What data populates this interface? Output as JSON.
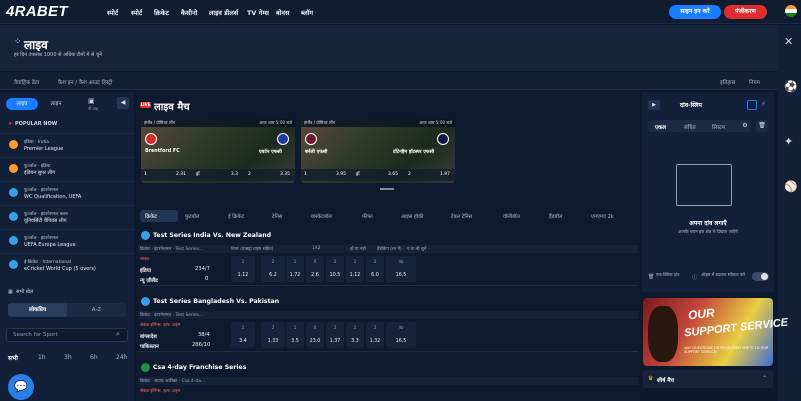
{
  "logo": "4RABET",
  "nav": [
    "स्पोर्ट",
    "स्पोर्ट",
    "क्रिकेट",
    "कैसीनो",
    "लाइव डीलर्स",
    "TV गेम्स",
    "बोनस",
    "ब्लॉग"
  ],
  "auth": {
    "login": "साइन इन करें",
    "register": "पंजीकरण"
  },
  "hero": {
    "title": "लाइव",
    "subtitle": "हर दिन उपलब्ध 1000 से अधिक टीमों में से चुनें"
  },
  "subnav": [
    "वैवाहिक ढेटा",
    "कैश इन / कैश आउट हिस्ट्री",
    "इतिहास",
    "नियम"
  ],
  "rightrail": [
    "",
    "",
    "",
    "",
    ""
  ],
  "sidebar": {
    "tab_live": "लाइव",
    "tab_prematch": "लाइन",
    "tab_extra": "नो वाद",
    "popular": "POPULAR NOW",
    "items": [
      {
        "l1": "इंडिया · India",
        "l2": "Premier League",
        "color": "#ff9933"
      },
      {
        "l1": "फुटबॉल · इंडिया",
        "l2": "इंडियन सुपर लीग",
        "color": "#ff9933"
      },
      {
        "l1": "फुटबॉल · इंटरनेशनल",
        "l2": "WC Qualification, UEFA",
        "color": "#3aa0e8"
      },
      {
        "l1": "फुटबॉल · इंटरनेशनल क्लब",
        "l2": "यूनिवर्सिटी चैंपियंस लीग",
        "color": "#3aa0e8"
      },
      {
        "l1": "फुटबॉल · इंटरनेशनल",
        "l2": "UEFA Europa League",
        "color": "#3aa0e8"
      },
      {
        "l1": "ई-क्रिकेट · International",
        "l2": "eCricket World Cup (5 overs)",
        "color": "#3aa0e8"
      }
    ],
    "all_sports": "सभी खेल",
    "seg_popular": "लोकप्रिय",
    "seg_az": "A-Z",
    "search_placeholder": "Search for Sport",
    "time_filters": [
      "सभी",
      "1h",
      "3h",
      "6h",
      "24h"
    ]
  },
  "main": {
    "live_badge": "LIVE",
    "title": "लाइव मैच",
    "cards": [
      {
        "league": "इंग्लैंड / प्रीमियर लीग",
        "time": "आज शाम 5:00 बजे",
        "home": "Brentford FC",
        "away": "एवर्टन एफसी",
        "o1": "2.31",
        "ox": "3.3",
        "o2": "3.35"
      },
      {
        "league": "इंग्लैंड / प्रीमियर लीग",
        "time": "आज शाम 5:00 बजे",
        "home": "बर्नली एफसी",
        "away": "टॉटेनहैम हॉटस्पर एफसी",
        "o1": "3.95",
        "ox": "3.65",
        "o2": "1.97"
      }
    ],
    "sport_tabs": [
      "क्रिकेट",
      "फुटबॉल",
      "ई क्रिकेट",
      "टेनिस",
      "बास्केटबॉल",
      "फीफा",
      "आइस हॉकी",
      "टेबल टेनिस",
      "वॉलीबॉल",
      "हैंडबॉल",
      "एमएमए 2k"
    ],
    "league1": {
      "name": "Test Series India Vs. New Zealand",
      "sub": "क्रिकेट · इंटरनेशनल · Test Series...",
      "h1": "विनर (एक्स्ट्रा टाइम सहित)",
      "h2": "1X2",
      "h3": "हाँ या नहीं",
      "h4": "हैंडीकैप (रन में)",
      "h5": "ए या बी चुनें",
      "live": "लाइव",
      "team1": "इंडिया",
      "team2": "न्यू ज़ीलैंड",
      "score1": "234/7",
      "score2": "0",
      "cells": [
        "1",
        "1.12",
        "2",
        "6.2",
        "1",
        "1.72",
        "X",
        "2.6",
        "2",
        "10.5",
        "1",
        "1.12",
        "2",
        "6.0",
        "पेड",
        "16.5"
      ]
    },
    "league2": {
      "name": "Test Series Bangladesh Vs. Pakistan",
      "sub": "क्रिकेट · इंटरनेशनल · Test Series...",
      "live": "सेकंड इनिंग्स, हाफ टाइम",
      "team1": "बांग्लादेश",
      "team2": "पाकिस्तान",
      "score1": "38/4",
      "score2": "286/10",
      "cells": [
        "1",
        "3.4",
        "2",
        "1.33",
        "1",
        "3.5",
        "X",
        "23.0",
        "2",
        "1.37",
        "1",
        "3.3",
        "2",
        "1.32",
        "पेड",
        "16.5"
      ]
    },
    "league3": {
      "name": "Csa 4-day Franchise Series",
      "sub": "क्रिकेट · साउथ अफ्रीका · Csa 4-da...",
      "live": "सेकंड इनिंग्स, हाफ टाइम"
    }
  },
  "betslip": {
    "title": "दांव-स्लिप",
    "tabs": [
      "एकल",
      "संचित",
      "सिस्टम"
    ],
    "empty_title": "अपना दांव लगाएँ",
    "empty_sub": "आपके चयन इस क्षेत्र में दिखाए जाएँगे",
    "opt1": "एक-क्लिक दांव",
    "opt2": "ऑड्स में बदलाव स्वीकार करें"
  },
  "promo": {
    "l1": "OUR",
    "l2": "SUPPORT SERVICE",
    "sub": "ANY QUESTIONS OR PROBLEMS? WRITE TO OUR SUPPORT SERVICE!"
  },
  "topmatch": "शीर्ष मैच",
  "colors": {
    "accent": "#1a7cff",
    "register": "#e02e2e",
    "bg": "#0d1a2e",
    "live": "#e02e2e"
  }
}
